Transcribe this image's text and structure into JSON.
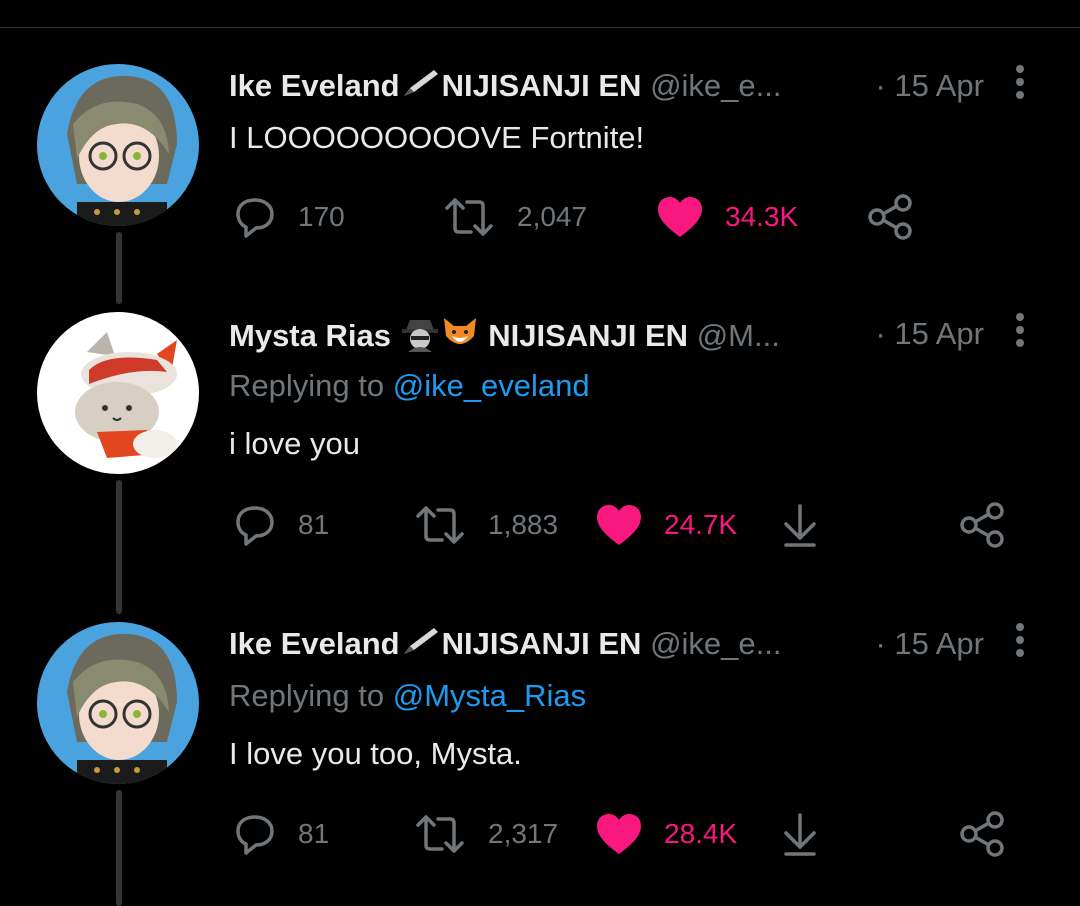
{
  "tweets": [
    {
      "name": "Ike Eveland",
      "name_suffix": "NIJISANJI EN",
      "handle": "@ike_e...",
      "date": "· 15 Apr",
      "replying_prefix": "",
      "replying_to": "",
      "text": "I LOOOOOOOOOVE Fortnite!",
      "replies": "170",
      "retweets": "2,047",
      "likes": "34.3K",
      "icons": [
        "reply-icon",
        "retweet-icon",
        "heart-filled-icon",
        "share-icon"
      ]
    },
    {
      "name": "Mysta Rias",
      "name_suffix": "NIJISANJI EN",
      "handle": "@M...",
      "date": "· 15 Apr",
      "replying_prefix": "Replying to ",
      "replying_to": "@ike_eveland",
      "text": "i love you",
      "replies": "81",
      "retweets": "1,883",
      "likes": "24.7K",
      "icons": [
        "reply-icon",
        "retweet-icon",
        "heart-filled-icon",
        "download-icon",
        "share-icon"
      ]
    },
    {
      "name": "Ike Eveland",
      "name_suffix": "NIJISANJI EN",
      "handle": "@ike_e...",
      "date": "· 15 Apr",
      "replying_prefix": "Replying to ",
      "replying_to": "@Mysta_Rias",
      "text": "I love you too, Mysta.",
      "replies": "81",
      "retweets": "2,317",
      "likes": "28.4K",
      "icons": [
        "reply-icon",
        "retweet-icon",
        "heart-filled-icon",
        "download-icon",
        "share-icon"
      ]
    }
  ],
  "colors": {
    "background": "#000000",
    "text": "#e7e9ea",
    "muted": "#71767b",
    "link": "#1d9bf0",
    "like": "#f91880",
    "thread_line": "#333639"
  }
}
